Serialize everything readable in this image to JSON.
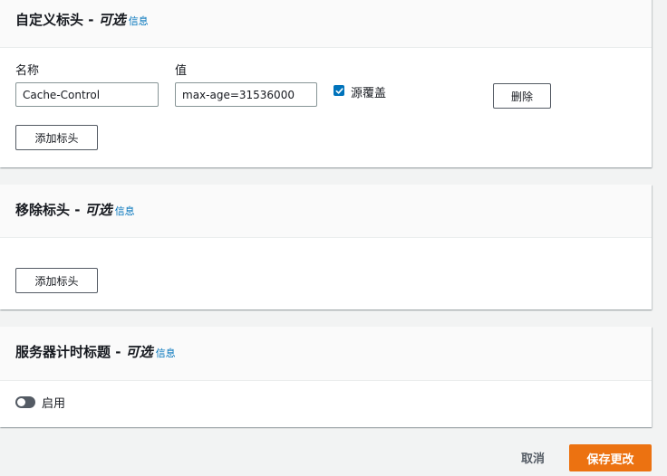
{
  "custom_headers": {
    "title": "自定义标头 - ",
    "optional": "可选",
    "info": "信息",
    "name_label": "名称",
    "value_label": "值",
    "header_name": "Cache-Control",
    "header_value": "max-age=31536000",
    "origin_override_label": "源覆盖",
    "origin_override_checked": true,
    "delete_label": "删除",
    "add_label": "添加标头"
  },
  "remove_headers": {
    "title": "移除标头 - ",
    "optional": "可选",
    "info": "信息",
    "add_label": "添加标头"
  },
  "server_timing": {
    "title": "服务器计时标题 - ",
    "optional": "可选",
    "info": "信息",
    "enable_label": "启用",
    "enabled": false
  },
  "footer": {
    "cancel_label": "取消",
    "save_label": "保存更改"
  },
  "colors": {
    "accent": "#ec7211",
    "link": "#0073bb",
    "checkbox": "#0073bb"
  }
}
